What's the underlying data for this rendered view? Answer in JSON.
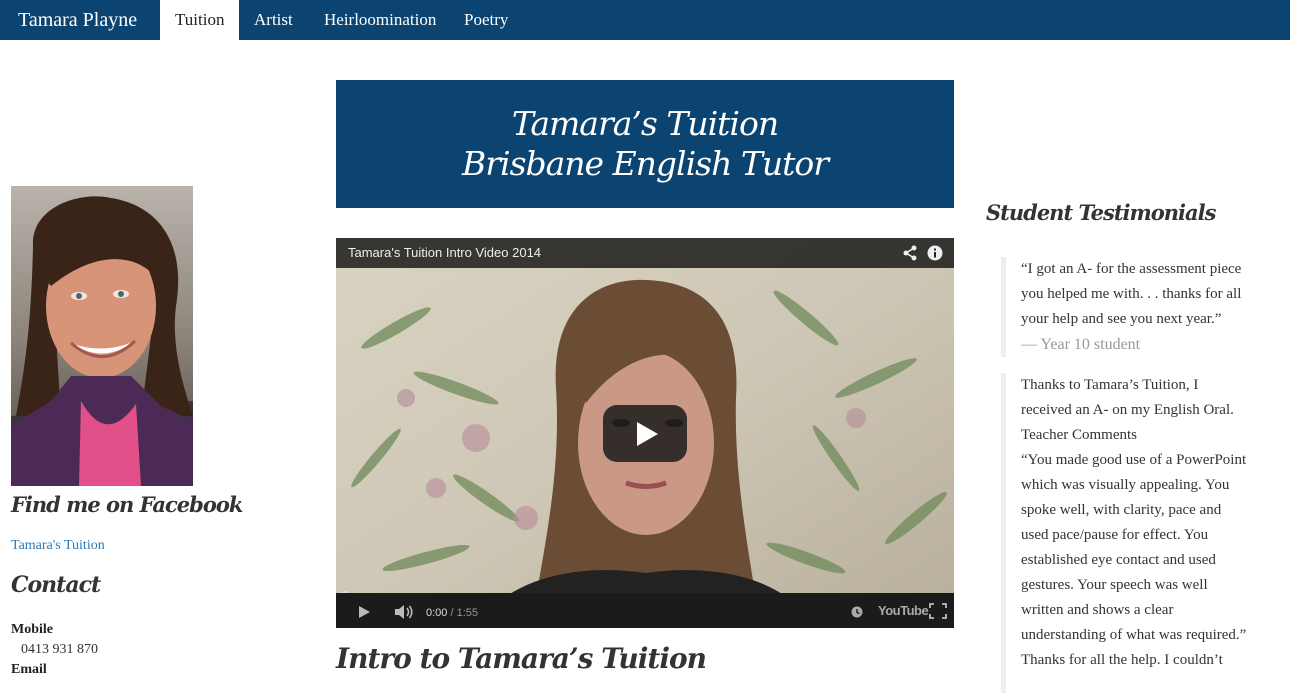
{
  "nav": {
    "brand": "Tamara Playne",
    "items": [
      {
        "label": "Tuition",
        "active": true
      },
      {
        "label": "Artist"
      },
      {
        "label": "Heirloomination"
      },
      {
        "label": "Poetry"
      }
    ]
  },
  "sidebar": {
    "facebook_heading": "Find me on Facebook",
    "facebook_link": "Tamara's Tuition",
    "contact_heading": "Contact",
    "mobile_label": "Mobile",
    "mobile_value": "0413 931 870",
    "email_label": "Email"
  },
  "hero": {
    "line1": "Tamara’s Tuition",
    "line2": "Brisbane English Tutor"
  },
  "video": {
    "title": "Tamara's Tuition Intro Video 2014",
    "current_time": "0:00",
    "separator": " / ",
    "duration": "1:55",
    "logo": "YouTube"
  },
  "intro_heading": "Intro to Tamara’s Tuition",
  "testimonials": {
    "heading": "Student Testimonials",
    "quote1": {
      "lines": [
        "“I got an A- for the assessment piece",
        "you helped me with. . . thanks for all",
        "your help and see you next year.”"
      ],
      "cite": "— Year 10 student"
    },
    "quote2": {
      "lines": [
        "Thanks to Tamara’s Tuition, I",
        "received an A- on my English Oral.",
        "Teacher Comments",
        "“You made good use of a PowerPoint",
        "which was visually appealing. You",
        "spoke well, with clarity, pace and",
        "used pace/pause for effect. You",
        "established eye contact and used",
        "gestures. Your speech was well",
        "written and shows a clear",
        "understanding of what was required.”",
        "Thanks for all the help. I couldn’t"
      ]
    }
  },
  "colors": {
    "brand_navy": "#0b4470",
    "link_blue": "#2a7ab8"
  }
}
